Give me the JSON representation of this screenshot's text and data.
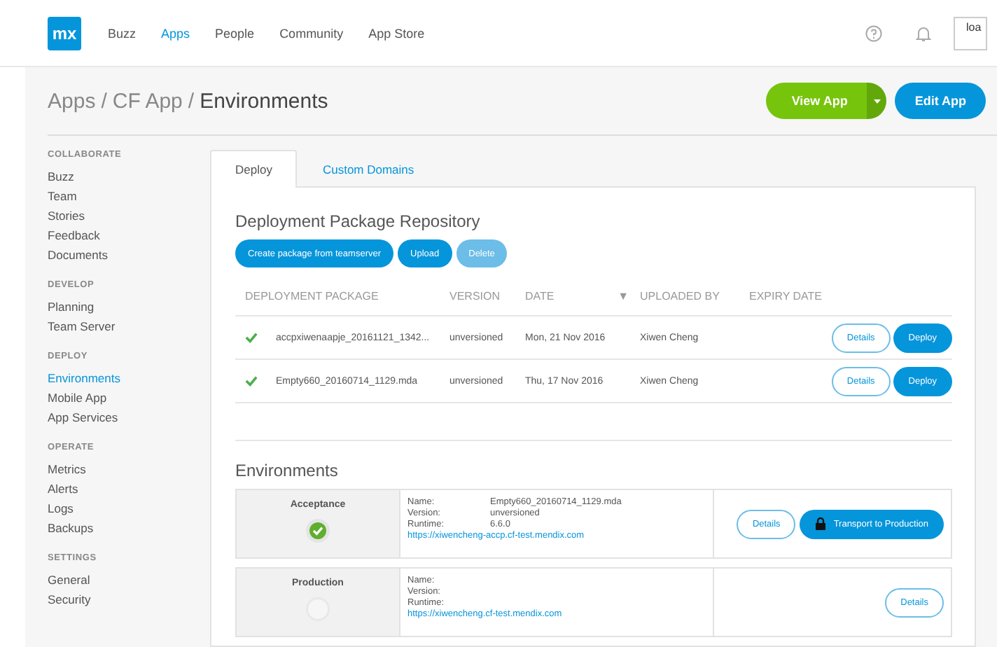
{
  "top_nav": {
    "logo": "mx",
    "items": [
      {
        "label": "Buzz",
        "selected": false
      },
      {
        "label": "Apps",
        "selected": true
      },
      {
        "label": "People",
        "selected": false
      },
      {
        "label": "Community",
        "selected": false
      },
      {
        "label": "App Store",
        "selected": false
      }
    ],
    "avatar_alt": "loa"
  },
  "breadcrumb": {
    "items": [
      "Apps",
      "CF App"
    ],
    "separator": "/",
    "current": "Environments"
  },
  "header_buttons": {
    "view": "View App",
    "edit": "Edit App"
  },
  "sidebar": [
    {
      "heading": "COLLABORATE",
      "items": [
        {
          "label": "Buzz",
          "selected": false
        },
        {
          "label": "Team",
          "selected": false
        },
        {
          "label": "Stories",
          "selected": false
        },
        {
          "label": "Feedback",
          "selected": false
        },
        {
          "label": "Documents",
          "selected": false
        }
      ]
    },
    {
      "heading": "DEVELOP",
      "items": [
        {
          "label": "Planning",
          "selected": false
        },
        {
          "label": "Team Server",
          "selected": false
        }
      ]
    },
    {
      "heading": "DEPLOY",
      "items": [
        {
          "label": "Environments",
          "selected": true
        },
        {
          "label": "Mobile App",
          "selected": false
        },
        {
          "label": "App Services",
          "selected": false
        }
      ]
    },
    {
      "heading": "OPERATE",
      "items": [
        {
          "label": "Metrics",
          "selected": false
        },
        {
          "label": "Alerts",
          "selected": false
        },
        {
          "label": "Logs",
          "selected": false
        },
        {
          "label": "Backups",
          "selected": false
        }
      ]
    },
    {
      "heading": "SETTINGS",
      "items": [
        {
          "label": "General",
          "selected": false
        },
        {
          "label": "Security",
          "selected": false
        }
      ]
    }
  ],
  "tabs": [
    {
      "label": "Deploy",
      "selected": true
    },
    {
      "label": "Custom Domains",
      "selected": false
    }
  ],
  "repository": {
    "title": "Deployment Package Repository",
    "buttons": [
      {
        "label": "Create package from teamserver",
        "disabled": false
      },
      {
        "label": "Upload",
        "disabled": false
      },
      {
        "label": "Delete",
        "disabled": true
      }
    ],
    "columns": [
      "DEPLOYMENT PACKAGE",
      "VERSION",
      "DATE",
      "UPLOADED BY",
      "EXPIRY DATE"
    ],
    "sort_indicator": "▼",
    "rows": [
      {
        "package": "accpxiwenaapje_20161121_1342...",
        "version": "unversioned",
        "date": "Mon, 21 Nov 2016",
        "uploaded_by": "Xiwen Cheng",
        "details": "Details",
        "deploy": "Deploy"
      },
      {
        "package": "Empty660_20160714_1129.mda",
        "version": "unversioned",
        "date": "Thu, 17 Nov 2016",
        "uploaded_by": "Xiwen Cheng",
        "details": "Details",
        "deploy": "Deploy"
      }
    ]
  },
  "environments": {
    "title": "Environments",
    "items": [
      {
        "name": "Acceptance",
        "kind": "running",
        "labels": [
          "Name:",
          "Version:",
          "Runtime:"
        ],
        "values": [
          "Empty660_20160714_1129.mda",
          "unversioned",
          "6.6.0"
        ],
        "url": "https://xiwencheng-accp.cf-test.mendix.com",
        "details": "Details",
        "transport": "Transport to Production"
      },
      {
        "name": "Production",
        "kind": "empty",
        "labels": [
          "Name:",
          "Version:",
          "Runtime:"
        ],
        "url": "https://xiwencheng.cf-test.mendix.com",
        "details": "Details"
      }
    ]
  }
}
